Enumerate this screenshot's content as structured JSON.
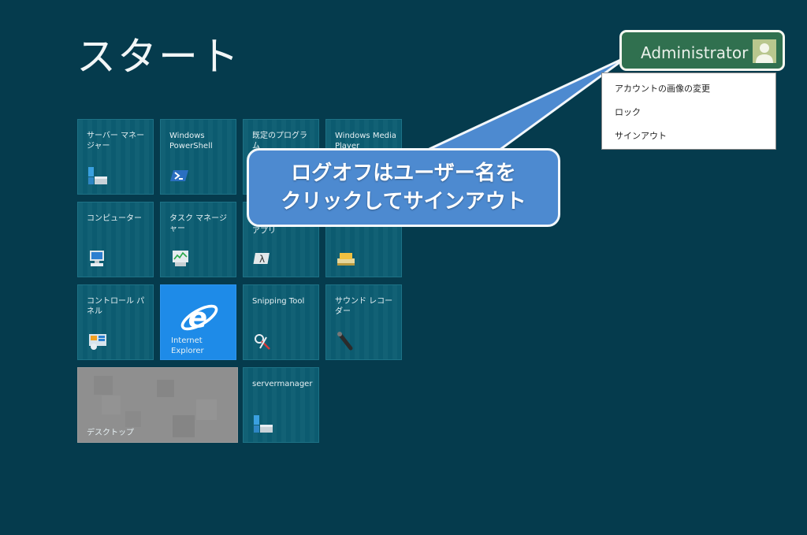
{
  "start": {
    "title": "スタート"
  },
  "user": {
    "name": "Administrator"
  },
  "menu": {
    "items": [
      "アカウントの画像の変更",
      "ロック",
      "サインアウト"
    ]
  },
  "callout": {
    "line1": "ログオフはユーザー名を",
    "line2": "クリックしてサインアウト"
  },
  "tiles": {
    "server_manager": "サーバー マネージャー",
    "powershell": "Windows PowerShell",
    "default_programs": "既定のプログラム",
    "media_player": "Windows Media Player",
    "computer": "コンピューター",
    "task_manager": "タスク マネージャー",
    "apps": "アプリ",
    "control_panel": "コントロール パネル",
    "ie": "Internet Explorer",
    "snipping": "Snipping Tool",
    "sound_recorder": "サウンド レコーダー",
    "desktop": "デスクトップ",
    "servermanager": "servermanager"
  },
  "colors": {
    "background": "#053b4d",
    "tile": "#0c5d72",
    "ie_tile": "#1e8be8",
    "user_box": "#30704f",
    "callout": "#4d8ad0"
  }
}
